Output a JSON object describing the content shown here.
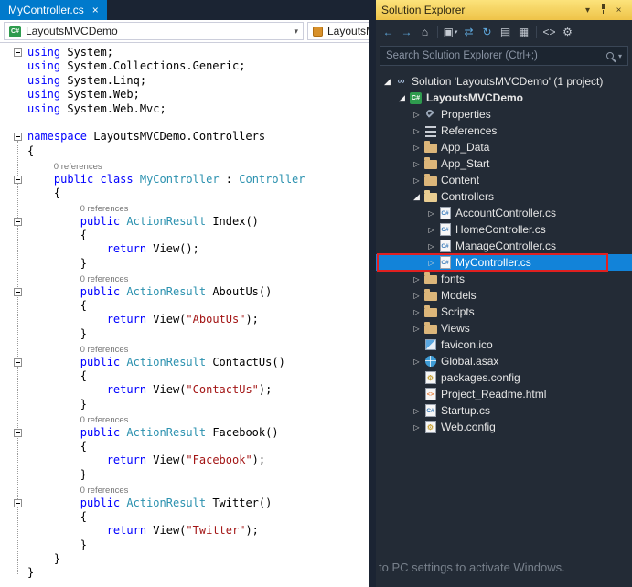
{
  "colors": {
    "accent_blue": "#007ACC",
    "selection_blue": "#1283D9",
    "annotation_red": "#E02020",
    "titlebar_yellow": "#EEC348",
    "chrome": "#1B2433",
    "solution_explorer_bg": "#232B36"
  },
  "icons": {
    "chevron_down": "▾",
    "close": "×",
    "expander_expanded": "◢",
    "expander_collapsed": "▷",
    "cs_label": "C#",
    "project_label": "C#",
    "html_label": "<>",
    "solution_label": "∞",
    "config_label": "⚙"
  },
  "editor": {
    "tab": {
      "title": "MyController.cs"
    },
    "navbar": {
      "project": "LayoutsMVCDemo",
      "member": "LayoutsMVC"
    },
    "lines": [
      {
        "fold": true,
        "t": [
          [
            "k",
            "using"
          ],
          [
            "p",
            " System;"
          ]
        ]
      },
      {
        "t": [
          [
            "k",
            "using"
          ],
          [
            "p",
            " System.Collections.Generic;"
          ]
        ]
      },
      {
        "t": [
          [
            "k",
            "using"
          ],
          [
            "p",
            " System.Linq;"
          ]
        ]
      },
      {
        "t": [
          [
            "k",
            "using"
          ],
          [
            "p",
            " System.Web;"
          ]
        ]
      },
      {
        "t": [
          [
            "k",
            "using"
          ],
          [
            "p",
            " System.Web.Mvc;"
          ]
        ]
      },
      {
        "t": []
      },
      {
        "fold": true,
        "t": [
          [
            "k",
            "namespace"
          ],
          [
            "p",
            " LayoutsMVCDemo.Controllers"
          ]
        ]
      },
      {
        "t": [
          [
            "p",
            "{"
          ]
        ]
      },
      {
        "lens": "0 references",
        "col": 4
      },
      {
        "fold": true,
        "t": [
          [
            "p",
            "    "
          ],
          [
            "k",
            "public"
          ],
          [
            "p",
            " "
          ],
          [
            "k",
            "class"
          ],
          [
            "p",
            " "
          ],
          [
            "y",
            "MyController"
          ],
          [
            "p",
            " : "
          ],
          [
            "y",
            "Controller"
          ]
        ]
      },
      {
        "t": [
          [
            "p",
            "    {"
          ]
        ]
      },
      {
        "lens": "0 references",
        "col": 8
      },
      {
        "fold": true,
        "t": [
          [
            "p",
            "        "
          ],
          [
            "k",
            "public"
          ],
          [
            "p",
            " "
          ],
          [
            "y",
            "ActionResult"
          ],
          [
            "p",
            " Index()"
          ]
        ]
      },
      {
        "t": [
          [
            "p",
            "        {"
          ]
        ]
      },
      {
        "t": [
          [
            "p",
            "            "
          ],
          [
            "k",
            "return"
          ],
          [
            "p",
            " View();"
          ]
        ]
      },
      {
        "t": [
          [
            "p",
            "        }"
          ]
        ]
      },
      {
        "lens": "0 references",
        "col": 8
      },
      {
        "fold": true,
        "t": [
          [
            "p",
            "        "
          ],
          [
            "k",
            "public"
          ],
          [
            "p",
            " "
          ],
          [
            "y",
            "ActionResult"
          ],
          [
            "p",
            " AboutUs()"
          ]
        ]
      },
      {
        "t": [
          [
            "p",
            "        {"
          ]
        ]
      },
      {
        "t": [
          [
            "p",
            "            "
          ],
          [
            "k",
            "return"
          ],
          [
            "p",
            " View("
          ],
          [
            "s",
            "\"AboutUs\""
          ],
          [
            "p",
            ");"
          ]
        ]
      },
      {
        "t": [
          [
            "p",
            "        }"
          ]
        ]
      },
      {
        "lens": "0 references",
        "col": 8
      },
      {
        "fold": true,
        "t": [
          [
            "p",
            "        "
          ],
          [
            "k",
            "public"
          ],
          [
            "p",
            " "
          ],
          [
            "y",
            "ActionResult"
          ],
          [
            "p",
            " ContactUs()"
          ]
        ]
      },
      {
        "t": [
          [
            "p",
            "        {"
          ]
        ]
      },
      {
        "t": [
          [
            "p",
            "            "
          ],
          [
            "k",
            "return"
          ],
          [
            "p",
            " View("
          ],
          [
            "s",
            "\"ContactUs\""
          ],
          [
            "p",
            ");"
          ]
        ]
      },
      {
        "t": [
          [
            "p",
            "        }"
          ]
        ]
      },
      {
        "lens": "0 references",
        "col": 8
      },
      {
        "fold": true,
        "t": [
          [
            "p",
            "        "
          ],
          [
            "k",
            "public"
          ],
          [
            "p",
            " "
          ],
          [
            "y",
            "ActionResult"
          ],
          [
            "p",
            " Facebook()"
          ]
        ]
      },
      {
        "t": [
          [
            "p",
            "        {"
          ]
        ]
      },
      {
        "t": [
          [
            "p",
            "            "
          ],
          [
            "k",
            "return"
          ],
          [
            "p",
            " View("
          ],
          [
            "s",
            "\"Facebook\""
          ],
          [
            "p",
            ");"
          ]
        ]
      },
      {
        "t": [
          [
            "p",
            "        }"
          ]
        ]
      },
      {
        "lens": "0 references",
        "col": 8
      },
      {
        "fold": true,
        "t": [
          [
            "p",
            "        "
          ],
          [
            "k",
            "public"
          ],
          [
            "p",
            " "
          ],
          [
            "y",
            "ActionResult"
          ],
          [
            "p",
            " Twitter()"
          ]
        ]
      },
      {
        "t": [
          [
            "p",
            "        {"
          ]
        ]
      },
      {
        "t": [
          [
            "p",
            "            "
          ],
          [
            "k",
            "return"
          ],
          [
            "p",
            " View("
          ],
          [
            "s",
            "\"Twitter\""
          ],
          [
            "p",
            ");"
          ]
        ]
      },
      {
        "t": [
          [
            "p",
            "        }"
          ]
        ]
      },
      {
        "t": [
          [
            "p",
            "    }"
          ]
        ]
      },
      {
        "t": [
          [
            "p",
            "}"
          ]
        ]
      }
    ]
  },
  "solution_explorer": {
    "title": "Solution Explorer",
    "search_placeholder": "Search Solution Explorer (Ctrl+;)",
    "watermark": "to PC settings to activate Windows.",
    "toolbar": [
      {
        "name": "back-button",
        "glyph": "←",
        "color": "#5FA8DC"
      },
      {
        "name": "forward-button",
        "glyph": "→",
        "color": "#5FA8DC"
      },
      {
        "name": "home-button",
        "glyph": "⌂",
        "color": "#C5CBD3"
      },
      {
        "sep": true
      },
      {
        "name": "scope-button",
        "glyph": "▣",
        "color": "#C5CBD3",
        "dd": true
      },
      {
        "name": "sync-with-active-document-button",
        "glyph": "⇄",
        "color": "#5FA8DC"
      },
      {
        "name": "refresh-button",
        "glyph": "↻",
        "color": "#5FA8DC"
      },
      {
        "name": "collapse-all-button",
        "glyph": "▤",
        "color": "#C5CBD3"
      },
      {
        "name": "show-all-files-button",
        "glyph": "▦",
        "color": "#C5CBD3"
      },
      {
        "sep": true
      },
      {
        "name": "view-code-button",
        "glyph": "<>",
        "color": "#C5CBD3"
      },
      {
        "name": "properties-button",
        "glyph": "⚙",
        "color": "#C5CBD3"
      }
    ],
    "tree": [
      {
        "indent": 0,
        "expander": "expanded",
        "icon": "solution",
        "label": "Solution 'LayoutsMVCDemo' (1 project)"
      },
      {
        "indent": 1,
        "expander": "expanded",
        "icon": "project",
        "label": "LayoutsMVCDemo",
        "bold": true
      },
      {
        "indent": 2,
        "expander": "collapsed",
        "icon": "properties",
        "label": "Properties"
      },
      {
        "indent": 2,
        "expander": "collapsed",
        "icon": "references",
        "label": "References"
      },
      {
        "indent": 2,
        "expander": "collapsed",
        "icon": "folder",
        "label": "App_Data"
      },
      {
        "indent": 2,
        "expander": "collapsed",
        "icon": "folder",
        "label": "App_Start"
      },
      {
        "indent": 2,
        "expander": "collapsed",
        "icon": "folder",
        "label": "Content"
      },
      {
        "indent": 2,
        "expander": "expanded",
        "icon": "folder-open",
        "label": "Controllers"
      },
      {
        "indent": 3,
        "expander": "collapsed",
        "icon": "cs",
        "label": "AccountController.cs"
      },
      {
        "indent": 3,
        "expander": "collapsed",
        "icon": "cs",
        "label": "HomeController.cs"
      },
      {
        "indent": 3,
        "expander": "collapsed",
        "icon": "cs",
        "label": "ManageController.cs"
      },
      {
        "indent": 3,
        "expander": "collapsed",
        "icon": "cs",
        "label": "MyController.cs",
        "selected": true,
        "annotated": true
      },
      {
        "indent": 2,
        "expander": "collapsed",
        "icon": "folder",
        "label": "fonts"
      },
      {
        "indent": 2,
        "expander": "collapsed",
        "icon": "folder",
        "label": "Models"
      },
      {
        "indent": 2,
        "expander": "collapsed",
        "icon": "folder",
        "label": "Scripts"
      },
      {
        "indent": 2,
        "expander": "collapsed",
        "icon": "folder",
        "label": "Views"
      },
      {
        "indent": 2,
        "expander": "none",
        "icon": "favicon",
        "label": "favicon.ico"
      },
      {
        "indent": 2,
        "expander": "collapsed",
        "icon": "globe",
        "label": "Global.asax"
      },
      {
        "indent": 2,
        "expander": "none",
        "icon": "config",
        "label": "packages.config"
      },
      {
        "indent": 2,
        "expander": "none",
        "icon": "html",
        "label": "Project_Readme.html"
      },
      {
        "indent": 2,
        "expander": "collapsed",
        "icon": "cs",
        "label": "Startup.cs"
      },
      {
        "indent": 2,
        "expander": "collapsed",
        "icon": "config",
        "label": "Web.config"
      }
    ]
  }
}
